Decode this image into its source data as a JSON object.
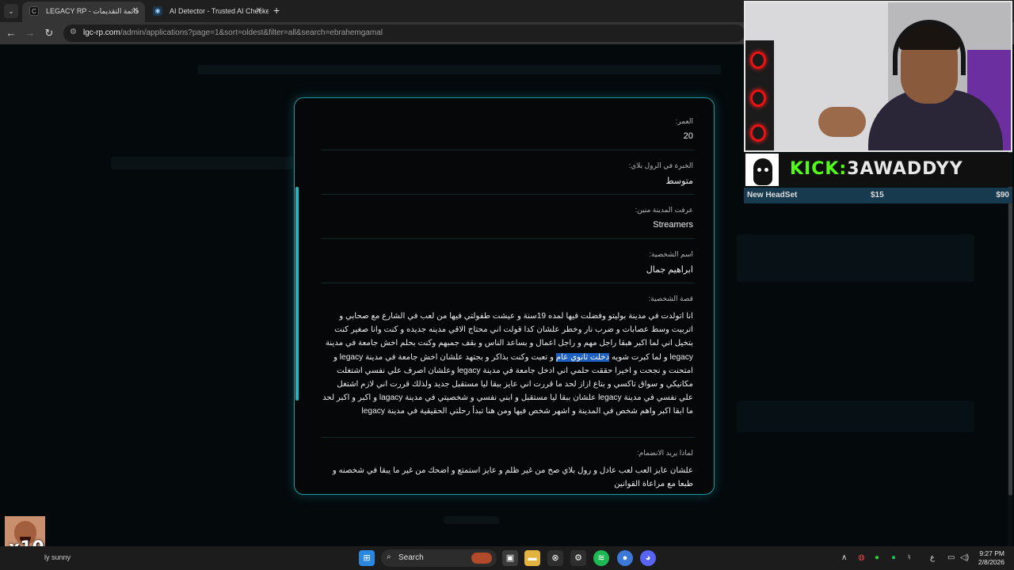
{
  "browser": {
    "tabs": [
      {
        "title": "LEGACY RP - قائمة التقديمات",
        "active": true
      },
      {
        "title": "AI Detector - Trusted AI Checke",
        "active": false
      }
    ],
    "url_host": "lgc-rp.com",
    "url_path": "/admin/applications?page=1&sort=oldest&filter=all&search=ebrahemgamal",
    "icons": {
      "back": "arrow-left",
      "forward": "arrow-right",
      "reload": "reload",
      "site_info": "tune",
      "new_tab": "plus",
      "close": "x",
      "tab_search": "chevron-down"
    }
  },
  "application": {
    "age": {
      "label": "العمر:",
      "value": "20"
    },
    "experience": {
      "label": "الخبرة في الرول بلاي:",
      "value": "متوسط"
    },
    "since": {
      "label": "عرفت المدينة منين:",
      "value": "Streamers"
    },
    "character_name": {
      "label": "اسم الشخصية:",
      "value": "ابراهيم جمال"
    },
    "story": {
      "label": "قصة الشخصية:",
      "text_before": "انا اتولدت في مدينة بوليتو وفضلت فيها لمده 19سنة و عيشت طفولتي فيها من لعب في الشارع مع صحابي و اتربيت وسط عصابات و ضرب نار وخطر علشان كدا قولت اني محتاج الاقي مدينه جديده و كنت وانا صغير كنت بتخيل اني لما اكبر هبقا راجل مهم و راجل اعمال و بساعد الناس و بقف جمبهم وكنت بحلم اخش جامعة في مدينة legacy و لما كبرت شويه ",
      "highlight": "دخلت ثانوي عام",
      "text_after": " و تعبت وكنت بذاكر و بجتهد علشان اخش جامعة في مدينة legacy و امتحنت و نجحت و اخيرا حققت حلمي اني ادخل جامعة في مدينة legacy وعلشان اصرف علي نفسي اشتغلت مكانيكي و سواق تاكسي و بتاع ازاز لحد ما قررت اني عايز ببقا ليا مستقبل جديد ولذلك قررت اني لازم اشتغل علي نفسي في مدينة legacy علشان ببقا ليا مستقبل و ابني نفسي و شخصيتي في مدينة lagacy و اكبر و اكبر لحد ما ابقا اكبر واهم شخص في المدينة و اشهر شخص فيها ومن هنا تبدأ رحلتي الحقيقية في مدينة legacy"
    },
    "reason": {
      "label": "لماذا يريد الانضمام:",
      "text": "علشان عايز العب لعب عادل و رول بلاي صح من غير ظلم و عايز استمتع و اضحك من غير ما يبقا في شخصنه و طبعا مع مراعاة القوانين"
    }
  },
  "overlay": {
    "kick_prefix": "KICK:",
    "kick_user": "3AWADDYY",
    "goal_name": "New HeadSet",
    "goal_current": "$15",
    "goal_target": "$90",
    "gif_text": "x10",
    "accent": "#53fc18"
  },
  "taskbar": {
    "weather": "ly sunny",
    "search_placeholder": "Search",
    "time": "9:27 PM",
    "date": "2/8/2026",
    "lang": "ع",
    "apps": [
      "start-icon",
      "task-view-icon",
      "file-explorer-icon",
      "xbox-icon",
      "steam-icon",
      "spotify-icon",
      "chrome-icon",
      "discord-icon"
    ]
  },
  "colors": {
    "modal_border": "#1a9aa0",
    "highlight": "#1e5fc2",
    "page_bg": "#04090c"
  }
}
